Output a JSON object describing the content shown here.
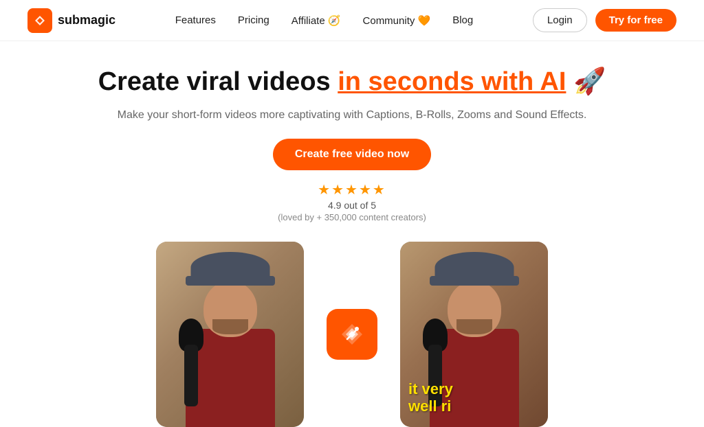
{
  "brand": {
    "name": "submagic",
    "logo_icon": "✦"
  },
  "nav": {
    "links": [
      {
        "label": "Features",
        "id": "features"
      },
      {
        "label": "Pricing",
        "id": "pricing"
      },
      {
        "label": "Affiliate 🧭",
        "id": "affiliate"
      },
      {
        "label": "Community 🧡",
        "id": "community"
      },
      {
        "label": "Blog",
        "id": "blog"
      }
    ],
    "login_label": "Login",
    "try_label": "Try for free"
  },
  "hero": {
    "title_plain": "Create viral videos ",
    "title_highlight": "in seconds with AI",
    "title_emoji": " 🚀",
    "subtitle": "Make your short-form videos more captivating with Captions, B-Rolls, Zooms and Sound Effects.",
    "cta_label": "Create free video now",
    "rating_stars": "★★★★★",
    "rating_score": "4.9 out of 5",
    "rating_sub": "(loved by + 350,000 content creators)"
  },
  "video": {
    "caption_line1": "it very",
    "caption_line2": "well ri"
  },
  "colors": {
    "accent": "#FF5500",
    "star": "#FF9500"
  }
}
